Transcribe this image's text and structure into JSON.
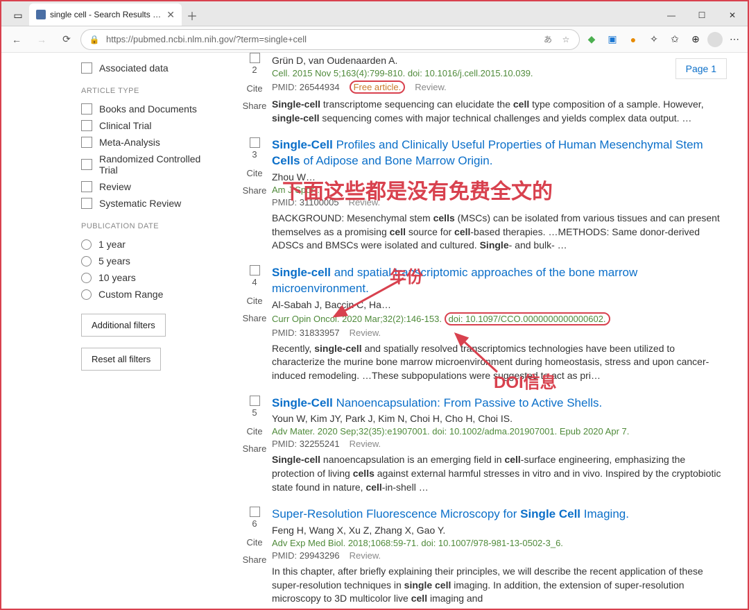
{
  "window": {
    "tab_title": "single cell - Search Results - Pub",
    "url": "https://pubmed.ncbi.nlm.nih.gov/?term=single+cell",
    "translate_label": "あ",
    "page_badge": "Page 1"
  },
  "sidebar": {
    "associated_data": "Associated data",
    "article_type_heading": "ARTICLE TYPE",
    "article_types": [
      "Books and Documents",
      "Clinical Trial",
      "Meta-Analysis",
      "Randomized Controlled Trial",
      "Review",
      "Systematic Review"
    ],
    "pub_date_heading": "PUBLICATION DATE",
    "pub_dates": [
      "1 year",
      "5 years",
      "10 years",
      "Custom Range"
    ],
    "additional_filters": "Additional filters",
    "reset_filters": "Reset all filters"
  },
  "labels": {
    "cite": "Cite",
    "share": "Share",
    "pmid": "PMID:",
    "review": "Review."
  },
  "results": [
    {
      "num": "2",
      "authors": "Grün D, van Oudenaarden A.",
      "journal": "Cell. 2015 Nov 5;163(4):799-810. doi: 10.1016/j.cell.2015.10.039.",
      "pmid": "26544934",
      "free": "Free article.",
      "snip_html": "<b>Single-cell</b> transcriptome sequencing can elucidate the <b>cell</b> type composition of a sample. However, <b>single-cell</b> sequencing comes with major technical challenges and yields complex data output. …"
    },
    {
      "num": "3",
      "title_html": "<b>Single-Cell</b> Profiles and Clinically Useful Properties of Human Mesenchymal Stem <b>Cells</b> of Adipose and Bone Marrow Origin.",
      "authors": "Zhou W…",
      "journal": "Am J Spor…",
      "pmid": "31100005",
      "snip_html": "BACKGROUND: Mesenchymal stem <b>cells</b> (MSCs) can be isolated from various tissues and can present themselves as a promising <b>cell</b> source for <b>cell</b>-based therapies. …METHODS: Same donor-derived ADSCs and BMSCs were isolated and cultured. <b>Single</b>- and bulk- …"
    },
    {
      "num": "4",
      "title_html": "<b>Single-cell</b> and spatial transcriptomic approaches of the bone marrow microenvironment.",
      "authors": "Al-Sabah J, Baccin C, Ha…",
      "journal_pre": "Curr Opin Oncol. 2020 Mar;32(2):146-153.",
      "journal_doi": "doi: 10.1097/CCO.0000000000000602.",
      "pmid": "31833957",
      "snip_html": "Recently, <b>single-cell</b> and spatially resolved transcriptomics technologies have been utilized to characterize the murine bone marrow microenvironment during homeostasis, stress and upon cancer-induced remodeling. …These subpopulations were suggested to act as pri…"
    },
    {
      "num": "5",
      "title_html": "<b>Single-Cell</b> Nanoencapsulation: From Passive to Active Shells.",
      "authors": "Youn W, Kim JY, Park J, Kim N, Choi H, Cho H, Choi IS.",
      "journal": "Adv Mater. 2020 Sep;32(35):e1907001. doi: 10.1002/adma.201907001. Epub 2020 Apr 7.",
      "pmid": "32255241",
      "snip_html": "<b>Single-cell</b> nanoencapsulation is an emerging field in <b>cell</b>-surface engineering, emphasizing the protection of living <b>cells</b> against external harmful stresses in vitro and in vivo. Inspired by the cryptobiotic state found in nature, <b>cell</b>-in-shell …"
    },
    {
      "num": "6",
      "title_html": "Super-Resolution Fluorescence Microscopy for <b>Single Cell</b> Imaging.",
      "authors": "Feng H, Wang X, Xu Z, Zhang X, Gao Y.",
      "journal": "Adv Exp Med Biol. 2018;1068:59-71. doi: 10.1007/978-981-13-0502-3_6.",
      "pmid": "29943296",
      "snip_html": "In this chapter, after briefly explaining their principles, we will describe the recent application of these super-resolution techniques in <b>single cell</b> imaging. In addition, the extension of super-resolution microscopy to 3D multicolor live <b>cell</b> imaging and"
    }
  ],
  "annotations": {
    "no_free_fulltext": "下面这些都是没有免费全文的",
    "year": "年份",
    "doi_info": "DOI信息"
  }
}
